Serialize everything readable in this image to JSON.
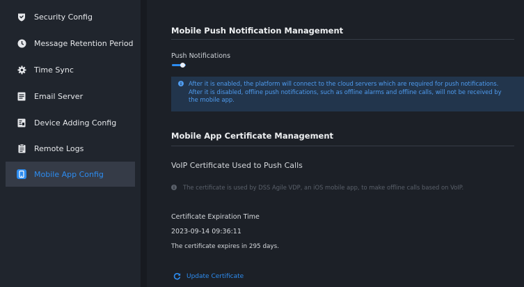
{
  "sidebar": {
    "items": [
      {
        "label": "Security Config",
        "icon": "shield-icon"
      },
      {
        "label": "Message Retention Period",
        "icon": "clock-icon"
      },
      {
        "label": "Time Sync",
        "icon": "gear-icon"
      },
      {
        "label": "Email Server",
        "icon": "email-icon"
      },
      {
        "label": "Device Adding Config",
        "icon": "device-icon"
      },
      {
        "label": "Remote Logs",
        "icon": "log-icon"
      },
      {
        "label": "Mobile App Config",
        "icon": "mobile-icon",
        "active": true
      }
    ]
  },
  "main": {
    "push_section": {
      "title": "Mobile Push Notification Management",
      "toggle_label": "Push Notifications",
      "toggle_on": true,
      "info_text": "After it is enabled, the platform will connect to the cloud servers which are required for push notifications.\nAfter it is disabled, offline push notifications, such as offline alarms and offline calls, will not be received by\nthe mobile app."
    },
    "cert_section": {
      "title": "Mobile App Certificate Management",
      "voip_title": "VoIP Certificate Used to Push Calls",
      "hint": "The certificate is used by DSS Agile VDP, an iOS mobile app, to make offline calls based on VoIP.",
      "expiration_label": "Certificate Expiration Time",
      "expiration_value": "2023-09-14 09:36:11",
      "expires_note": "The certificate expires in 295 days.",
      "update_label": "Update Certificate"
    }
  },
  "colors": {
    "accent": "#2d8cf0",
    "background": "#1c2027",
    "sidebar": "#20252d",
    "active_item": "#353b47",
    "info_bg": "#22354c"
  }
}
